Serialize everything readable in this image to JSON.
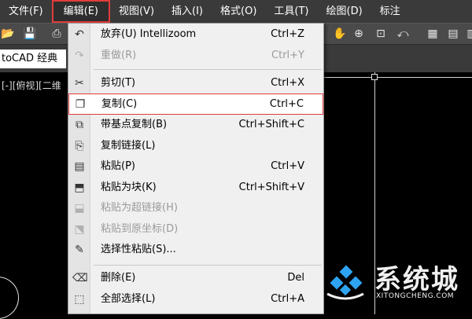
{
  "menubar": {
    "items": [
      "文件(F)",
      "编辑(E)",
      "视图(V)",
      "插入(I)",
      "格式(O)",
      "工具(T)",
      "绘图(D)",
      "标注"
    ],
    "active_index": 1
  },
  "workspace": {
    "value": "toCAD 经典"
  },
  "viewport": {
    "label": "[-][俯视][二维"
  },
  "edit_menu": {
    "items": [
      {
        "label": "放弃(U) Intellizoom",
        "shortcut": "Ctrl+Z",
        "icon": "undo-icon",
        "glyph": "↶",
        "enabled": true
      },
      {
        "label": "重做(R)",
        "shortcut": "Ctrl+Y",
        "icon": "redo-icon",
        "glyph": "↷",
        "enabled": false
      },
      {
        "label": "剪切(T)",
        "shortcut": "Ctrl+X",
        "icon": "scissors-icon",
        "glyph": "✂",
        "enabled": true
      },
      {
        "label": "复制(C)",
        "shortcut": "Ctrl+C",
        "icon": "copy-icon",
        "glyph": "❐",
        "enabled": true,
        "highlighted": true
      },
      {
        "label": "带基点复制(B)",
        "shortcut": "Ctrl+Shift+C",
        "icon": "copy-base-icon",
        "glyph": "⧉",
        "enabled": true
      },
      {
        "label": "复制链接(L)",
        "shortcut": "",
        "icon": "copy-link-icon",
        "glyph": "⎘",
        "enabled": true
      },
      {
        "label": "粘贴(P)",
        "shortcut": "Ctrl+V",
        "icon": "paste-icon",
        "glyph": "📋",
        "enabled": true
      },
      {
        "label": "粘贴为块(K)",
        "shortcut": "Ctrl+Shift+V",
        "icon": "paste-block-icon",
        "glyph": "⬒",
        "enabled": true
      },
      {
        "label": "粘贴为超链接(H)",
        "shortcut": "",
        "icon": "paste-hyperlink-icon",
        "glyph": "⬓",
        "enabled": false
      },
      {
        "label": "粘贴到原坐标(D)",
        "shortcut": "",
        "icon": "paste-coords-icon",
        "glyph": "⬔",
        "enabled": false
      },
      {
        "label": "选择性粘贴(S)...",
        "shortcut": "",
        "icon": "paste-special-icon",
        "glyph": "✎",
        "enabled": true
      },
      {
        "label": "删除(E)",
        "shortcut": "Del",
        "icon": "eraser-icon",
        "glyph": "⌫",
        "enabled": true
      },
      {
        "label": "全部选择(L)",
        "shortcut": "Ctrl+A",
        "icon": "select-all-icon",
        "glyph": "⬚",
        "enabled": true
      }
    ]
  },
  "watermark": {
    "text": "系统城",
    "url": "XITONGCHENG.COM"
  },
  "colors": {
    "highlight_border": "#e23b3b",
    "menu_bg": "#f0f0f0",
    "bar_bg": "#3a3a3a"
  }
}
